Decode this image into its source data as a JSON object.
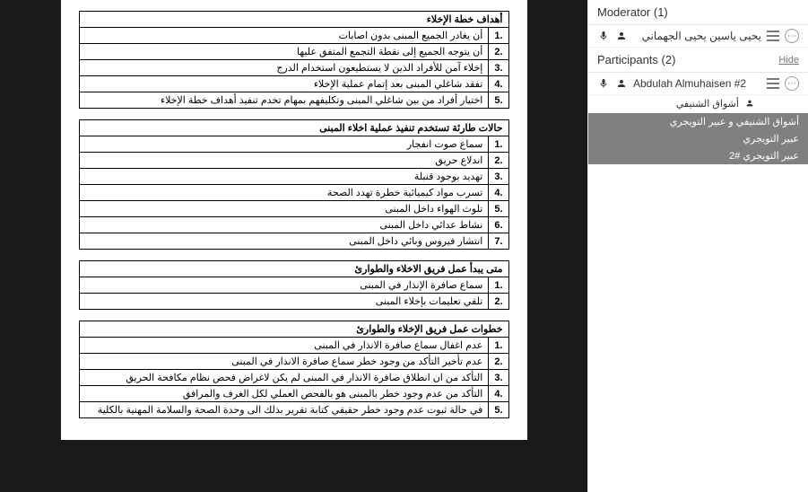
{
  "document": {
    "tables": [
      {
        "title": "أهداف خطة الإخلاء",
        "rows": [
          "أن يغادر الجميع المبنى بدون اصابات",
          "أن يتوجه الجميع إلى نقطة التجمع المتفق عليها",
          "إخلاء آمن للأفراد الذين لا يستطيعون استخدام الدرج",
          "تفقد شاغلي المبنى بعد إتمام عملية الإخلاء",
          "اختيار أفراد من بين شاغلي المبنى وتكليفهم بمهام تخدم تنفيذ أهداف خطة الإخلاء"
        ]
      },
      {
        "title": "حالات طارئة تستخدم تنفيذ عملية اخلاء المبنى",
        "rows": [
          "سماع صوت انفجار",
          "اندلاع حريق",
          "تهديد بوجود قنبلة",
          "تسرب مواد كيميائية خطرة تهدد الصحة",
          "تلوث الهواء داخل المبنى",
          "نشاط عدائي داخل المبنى",
          "انتشار فيروس وبائي داخل المبنى"
        ]
      },
      {
        "title": "متى يبدأ عمل فريق الاخلاء والطوارئ",
        "rows": [
          "سماع صافرة الإنذار في المبنى",
          "تلقي تعليمات بإخلاء المبنى"
        ]
      },
      {
        "title": "خطوات عمل فريق الإخلاء والطوارئ",
        "rows": [
          "عدم اغفال سماع صافرة الانذار في المبنى",
          "عدم تأخير التأكد من وجود خطر سماع صافرة الانذار في المبنى",
          "التأكد من ان انطلاق صافرة الانذار في المبنى لم يكن لاغراض فحص نظام مكافحة الحريق",
          "التأكد من عدم وجود خطر بالمبنى هو بالفحص العملي لكل الغرف والمرافق",
          "في حالة ثبوت عدم وجود خطر حقيقي كتابة تقرير بذلك الى وحدة الصحة والسلامة المهنية بالكلية"
        ]
      }
    ]
  },
  "panel": {
    "moderator_header": "Moderator (1)",
    "participants_header": "Participants (2)",
    "hide": "Hide",
    "moderator": "يحيى ياسين يحيى الجهماني",
    "participant1": "Abdulah Almuhaisen #2",
    "sub1": "أشواق الشنيفي",
    "sub2": "أشواق الشنيفي و عبير التويجري",
    "sub3": "عبير التويجري",
    "sub4": "عبير التويجري #2"
  }
}
